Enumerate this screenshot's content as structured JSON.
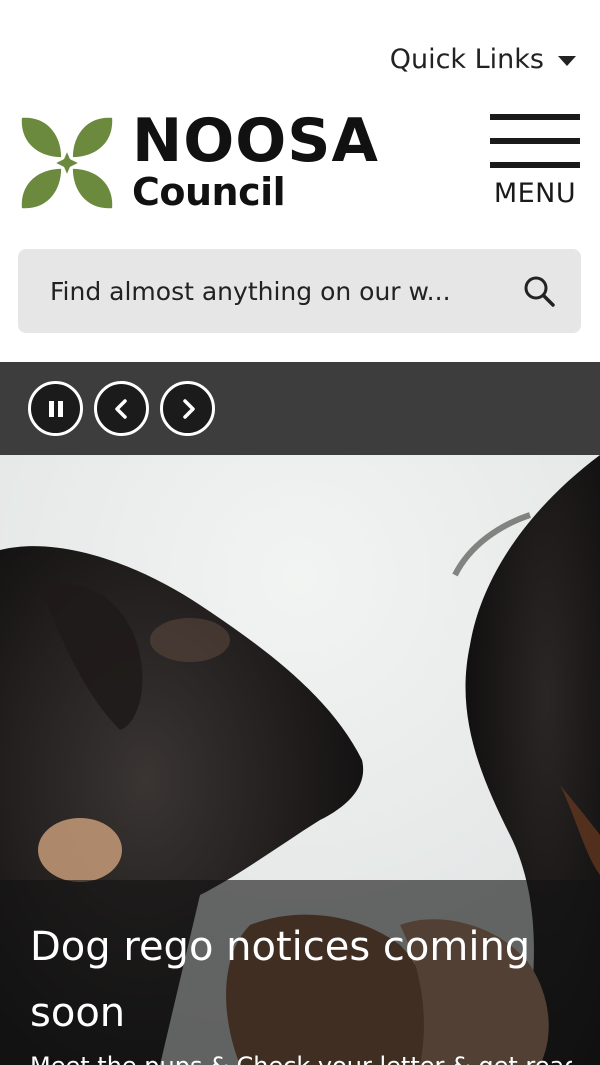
{
  "header": {
    "quick_links_label": "Quick Links",
    "logo": {
      "line1": "NOOSA",
      "line2": "Council",
      "leaf_color": "#6b8a3e"
    },
    "menu_label": "MENU"
  },
  "search": {
    "placeholder": "Find almost anything on our w..."
  },
  "carousel": {
    "controls": [
      "pause",
      "previous",
      "next"
    ],
    "slide": {
      "title": "Dog rego notices coming soon",
      "subtitle": "Meet the pups & Check your letter & get ready"
    }
  },
  "colors": {
    "controls_bar": "#3d3d3d",
    "search_bg": "#e6e6e6",
    "caption_overlay": "rgba(20,20,20,0.62)"
  }
}
